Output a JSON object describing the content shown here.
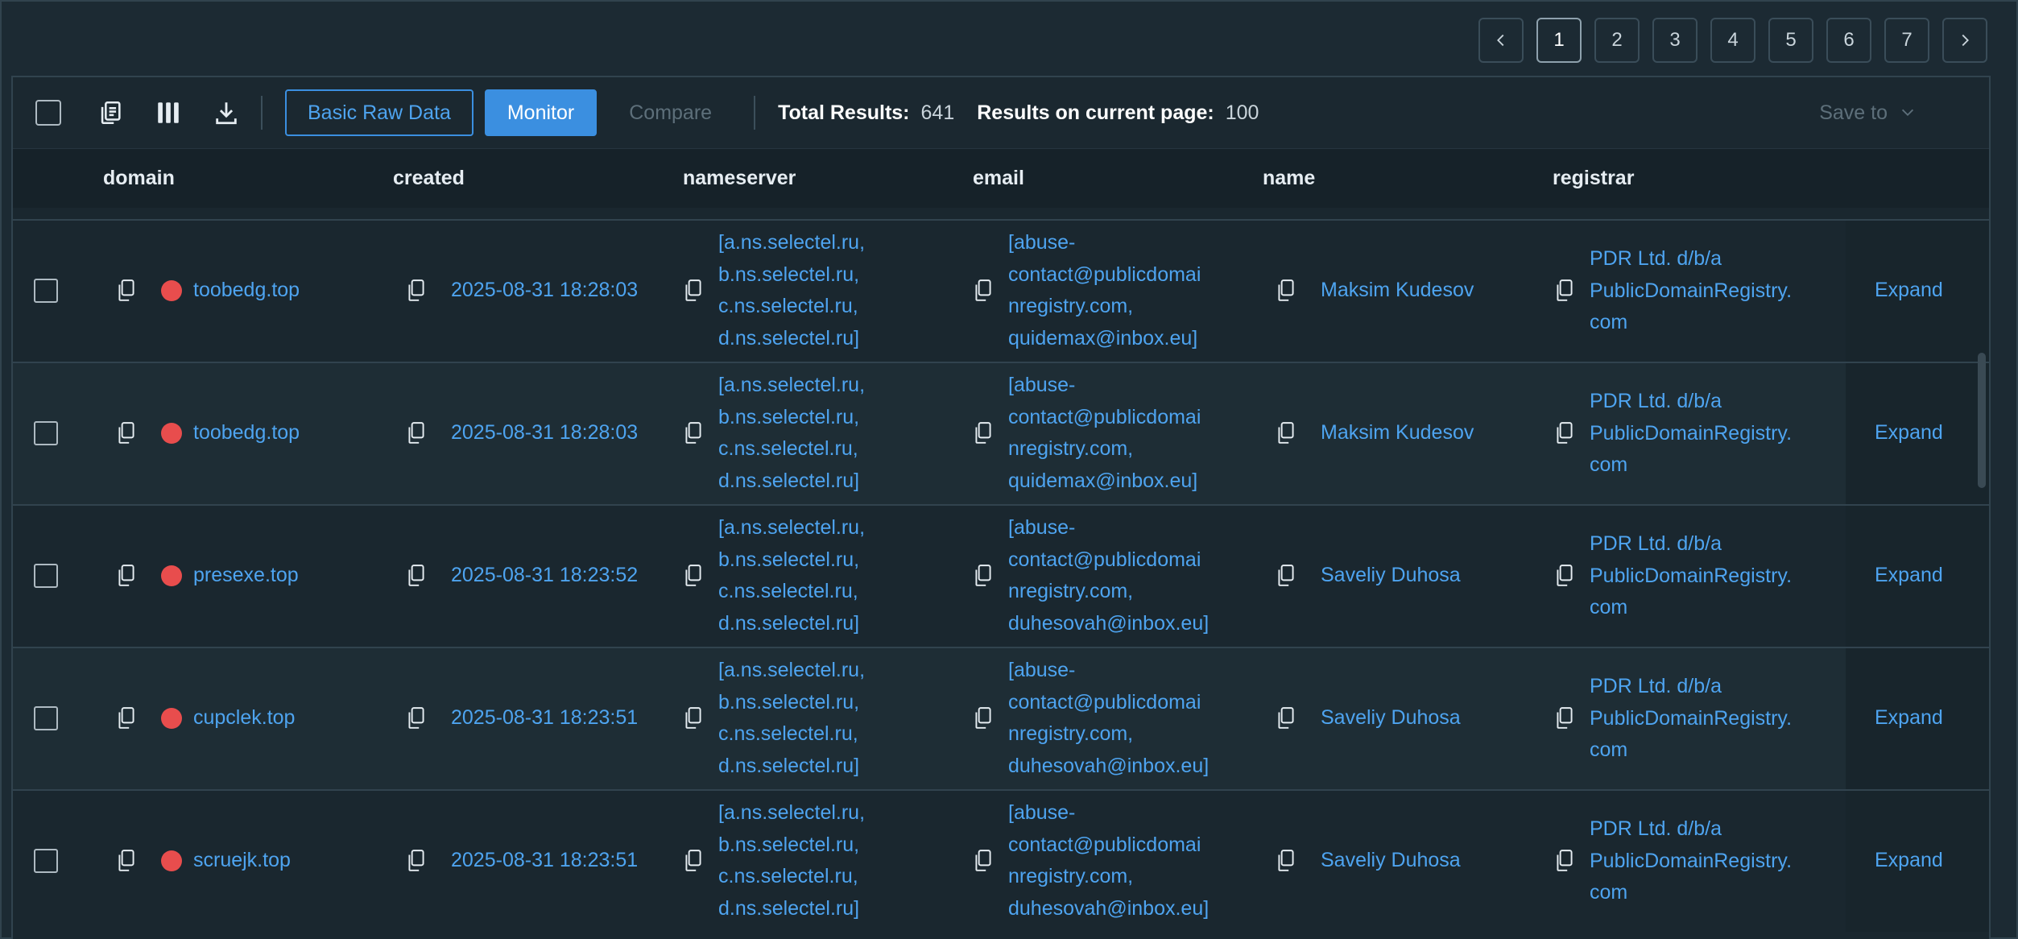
{
  "pagination": {
    "pages": [
      "1",
      "2",
      "3",
      "4",
      "5",
      "6",
      "7"
    ],
    "current": "1",
    "prev_icon": "chevron-left-icon",
    "next_icon": "chevron-right-icon"
  },
  "toolbar": {
    "basic_raw_label": "Basic Raw Data",
    "monitor_label": "Monitor",
    "compare_label": "Compare",
    "total_results_label": "Total Results:",
    "total_results_value": "641",
    "page_results_label": "Results on current page:",
    "page_results_value": "100",
    "save_to_label": "Save to"
  },
  "columns": [
    "domain",
    "created",
    "nameserver",
    "email",
    "name",
    "registrar"
  ],
  "rows": [
    {
      "domain": "toobedg.top",
      "created": "2025-08-31 18:28:03",
      "nameserver": [
        "[a.ns.selectel.ru,",
        "b.ns.selectel.ru,",
        "c.ns.selectel.ru,",
        "d.ns.selectel.ru]"
      ],
      "email": [
        "[abuse-",
        "contact@publicdomai",
        "nregistry.com,",
        "quidemax@inbox.eu]"
      ],
      "name": "Maksim Kudesov",
      "registrar": [
        "PDR Ltd. d/b/a",
        "PublicDomainRegistry.",
        "com"
      ],
      "action": "Expand"
    },
    {
      "domain": "toobedg.top",
      "created": "2025-08-31 18:28:03",
      "nameserver": [
        "[a.ns.selectel.ru,",
        "b.ns.selectel.ru,",
        "c.ns.selectel.ru,",
        "d.ns.selectel.ru]"
      ],
      "email": [
        "[abuse-",
        "contact@publicdomai",
        "nregistry.com,",
        "quidemax@inbox.eu]"
      ],
      "name": "Maksim Kudesov",
      "registrar": [
        "PDR Ltd. d/b/a",
        "PublicDomainRegistry.",
        "com"
      ],
      "action": "Expand"
    },
    {
      "domain": "presexe.top",
      "created": "2025-08-31 18:23:52",
      "nameserver": [
        "[a.ns.selectel.ru,",
        "b.ns.selectel.ru,",
        "c.ns.selectel.ru,",
        "d.ns.selectel.ru]"
      ],
      "email": [
        "[abuse-",
        "contact@publicdomai",
        "nregistry.com,",
        "duhesovah@inbox.eu]"
      ],
      "name": "Saveliy Duhosa",
      "registrar": [
        "PDR Ltd. d/b/a",
        "PublicDomainRegistry.",
        "com"
      ],
      "action": "Expand"
    },
    {
      "domain": "cupclek.top",
      "created": "2025-08-31 18:23:51",
      "nameserver": [
        "[a.ns.selectel.ru,",
        "b.ns.selectel.ru,",
        "c.ns.selectel.ru,",
        "d.ns.selectel.ru]"
      ],
      "email": [
        "[abuse-",
        "contact@publicdomai",
        "nregistry.com,",
        "duhesovah@inbox.eu]"
      ],
      "name": "Saveliy Duhosa",
      "registrar": [
        "PDR Ltd. d/b/a",
        "PublicDomainRegistry.",
        "com"
      ],
      "action": "Expand"
    },
    {
      "domain": "scruejk.top",
      "created": "2025-08-31 18:23:51",
      "nameserver": [
        "[a.ns.selectel.ru,",
        "b.ns.selectel.ru,",
        "c.ns.selectel.ru,",
        "d.ns.selectel.ru]"
      ],
      "email": [
        "[abuse-",
        "contact@publicdomai",
        "nregistry.com,",
        "duhesovah@inbox.eu]"
      ],
      "name": "Saveliy Duhosa",
      "registrar": [
        "PDR Ltd. d/b/a",
        "PublicDomainRegistry.",
        "com"
      ],
      "action": "Expand"
    }
  ],
  "colors": {
    "background": "#1c2a33",
    "accent": "#3b8fe0",
    "link": "#4ea4f0",
    "status_dot": "#e84d4d"
  },
  "icons": {
    "copy": "copy-icon",
    "columns": "columns-icon",
    "download": "download-icon",
    "dropdown": "chevron-down-icon"
  }
}
